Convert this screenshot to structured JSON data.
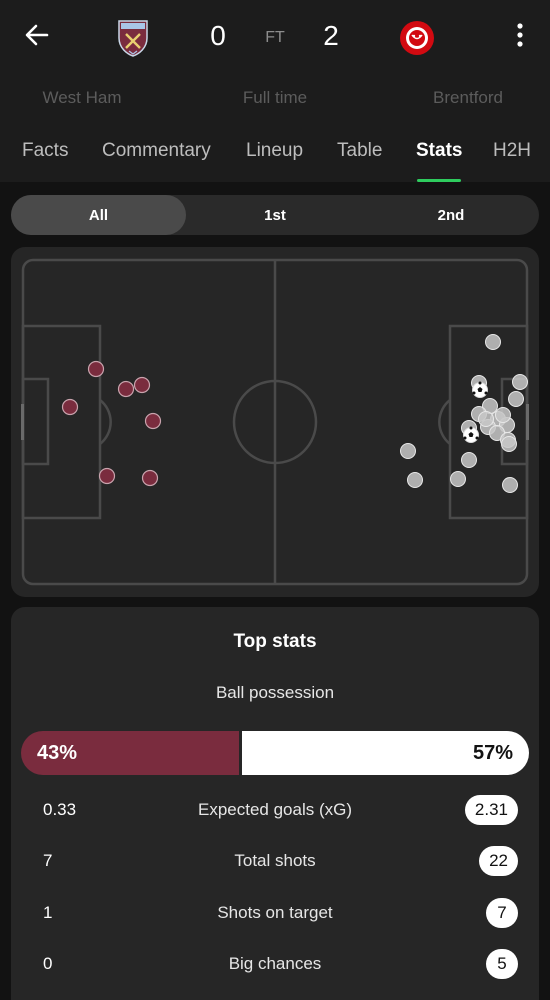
{
  "header": {
    "home_team": "West Ham",
    "away_team": "Brentford",
    "home_score": "0",
    "away_score": "2",
    "status_short": "FT",
    "status_long": "Full time",
    "icons": [
      "back-arrow-icon",
      "west-ham-crest-icon",
      "brentford-crest-icon",
      "more-vertical-icon"
    ]
  },
  "tabs": [
    {
      "label": "Facts"
    },
    {
      "label": "Commentary"
    },
    {
      "label": "Lineup"
    },
    {
      "label": "Table"
    },
    {
      "label": "Stats",
      "active": true
    },
    {
      "label": "H2H"
    }
  ],
  "periods": [
    {
      "label": "All",
      "active": true
    },
    {
      "label": "1st"
    },
    {
      "label": "2nd"
    }
  ],
  "shot_map": {
    "home_color": "#7a2c3e",
    "away_color": "#c8c8c8",
    "home_shots": 7,
    "away_shots": 22,
    "away_goals": 2
  },
  "top_stats": {
    "title": "Top stats",
    "possession": {
      "label": "Ball possession",
      "home": "43%",
      "away": "57%",
      "home_fraction": 0.43
    },
    "rows": [
      {
        "label": "Expected goals (xG)",
        "home": "0.33",
        "away": "2.31"
      },
      {
        "label": "Total shots",
        "home": "7",
        "away": "22"
      },
      {
        "label": "Shots on target",
        "home": "1",
        "away": "7"
      },
      {
        "label": "Big chances",
        "home": "0",
        "away": "5"
      }
    ]
  },
  "colors": {
    "accent": "#2ecc5e",
    "home": "#7a2c3e",
    "away": "#ffffff"
  }
}
